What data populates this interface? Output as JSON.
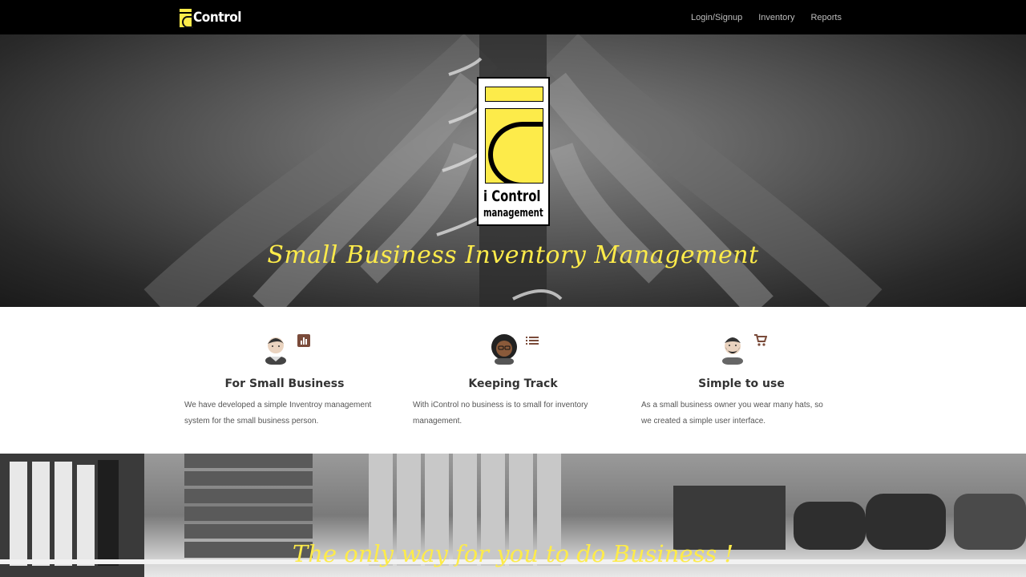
{
  "nav": {
    "brand": "Control",
    "links": [
      "Login/Signup",
      "Inventory",
      "Reports"
    ]
  },
  "hero": {
    "logo_line1": "i Control",
    "logo_line2": "management",
    "tagline": "Small Business Inventory Management"
  },
  "features": [
    {
      "title": "For Small Business",
      "text": "We have developed a simple Inventroy management system for the small business person.",
      "icon": "bar-chart-icon",
      "avatar": "man-avatar"
    },
    {
      "title": "Keeping Track",
      "text": "With iControl no business is to small for inventory management.",
      "icon": "list-icon",
      "avatar": "woman-avatar"
    },
    {
      "title": "Simple to use",
      "text": "As a small business owner you wear many hats, so we created a simple user interface.",
      "icon": "shopping-cart-icon",
      "avatar": "bearded-man-avatar"
    }
  ],
  "bottom": {
    "tagline": "The only way for you to do Business !"
  },
  "colors": {
    "accent": "#fdeb4a",
    "icon": "#7a4b3a",
    "navbar": "#000000"
  }
}
